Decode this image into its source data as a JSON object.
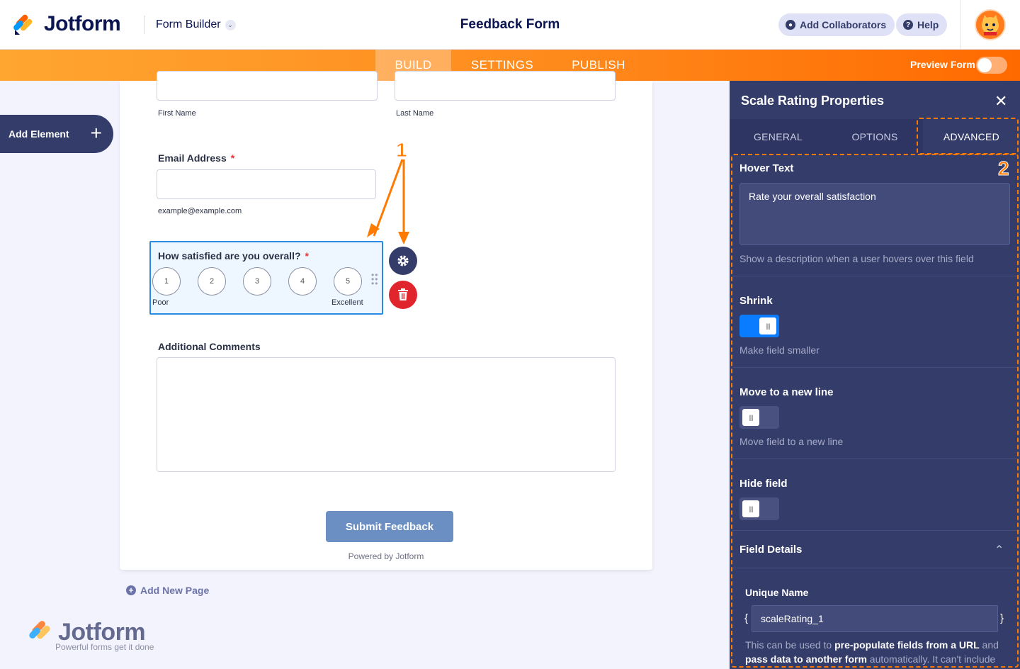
{
  "header": {
    "logo_text": "Jotform",
    "builder_label": "Form Builder",
    "form_title": "Feedback Form",
    "add_collaborators": "Add Collaborators",
    "help": "Help"
  },
  "nav": {
    "tabs": [
      "BUILD",
      "SETTINGS",
      "PUBLISH"
    ],
    "active_tab": "BUILD",
    "preview_label": "Preview Form",
    "preview_on": false
  },
  "sidebar": {
    "add_element": "Add Element"
  },
  "form": {
    "first_name_label": "First Name",
    "last_name_label": "Last Name",
    "email_label": "Email Address",
    "required_mark": "*",
    "email_hint": "example@example.com",
    "scale": {
      "question": "How satisfied are you overall?",
      "options": [
        "1",
        "2",
        "3",
        "4",
        "5"
      ],
      "low_label": "Poor",
      "high_label": "Excellent"
    },
    "comments_label": "Additional Comments",
    "submit_label": "Submit Feedback",
    "powered_by": "Powered by Jotform",
    "add_page": "Add New Page"
  },
  "watermark": {
    "brand": "Jotform",
    "tagline": "Powerful forms get it done"
  },
  "annotations": {
    "marker_1": "1",
    "marker_2": "2"
  },
  "panel": {
    "title": "Scale Rating Properties",
    "tabs": [
      "GENERAL",
      "OPTIONS",
      "ADVANCED"
    ],
    "active_tab": "ADVANCED",
    "hover_text": {
      "title": "Hover Text",
      "value": "Rate your overall satisfaction",
      "desc": "Show a description when a user hovers over this field"
    },
    "shrink": {
      "title": "Shrink",
      "desc": "Make field smaller",
      "on": true
    },
    "new_line": {
      "title": "Move to a new line",
      "desc": "Move field to a new line",
      "on": false
    },
    "hide": {
      "title": "Hide field",
      "on": false
    },
    "details": {
      "title": "Field Details",
      "unique_name_label": "Unique Name",
      "brace_open": "{",
      "brace_close": "}",
      "unique_name": "scaleRating_1",
      "desc_1": "This can be used to ",
      "desc_2": "pre-populate fields from a URL",
      "desc_3": " and ",
      "desc_4": "pass data to another form",
      "desc_5": " automatically. It can't include"
    }
  },
  "colors": {
    "accent": "#ff7a00",
    "panel": "#343c6a",
    "selected": "#2a8be3",
    "danger": "#e0262c"
  }
}
